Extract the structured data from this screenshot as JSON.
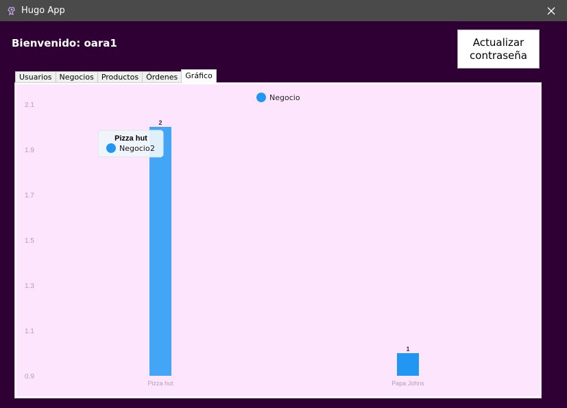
{
  "window": {
    "title": "Hugo App"
  },
  "header": {
    "welcome": "Bienvenido: oara1",
    "update_password_label": "Actualizar\ncontraseña"
  },
  "tabs": [
    {
      "label": "Usuarios",
      "active": false
    },
    {
      "label": "Negocios",
      "active": false
    },
    {
      "label": "Productos",
      "active": false
    },
    {
      "label": "Órdenes",
      "active": false
    },
    {
      "label": "Gráfico",
      "active": true
    }
  ],
  "colors": {
    "window_bg": "#2e0033",
    "titlebar": "#4a4a4a",
    "chart_bg": "#fde6fd",
    "bar": "#42a5f5",
    "series": "#2196f3"
  },
  "chart_data": {
    "type": "bar",
    "categories": [
      "Pizza hut",
      "Papa Johns"
    ],
    "series": [
      {
        "name": "Negocio",
        "values": [
          2,
          1
        ]
      }
    ],
    "ylim": [
      0.9,
      2.1
    ],
    "yticks": [
      "0.9",
      "1.1",
      "1.3",
      "1.5",
      "1.7",
      "1.9",
      "2.1"
    ],
    "data_labels": [
      "2",
      "1"
    ],
    "legend": "top-center",
    "grid": false,
    "tooltip": {
      "title": "Pizza hut",
      "series": "Negocio",
      "value": "2"
    }
  }
}
